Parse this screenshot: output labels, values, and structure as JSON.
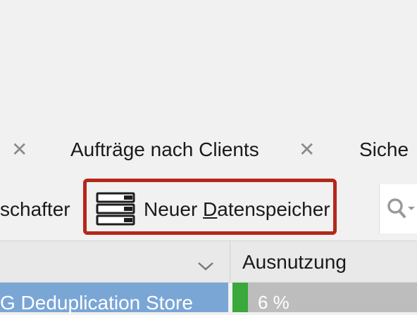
{
  "tabs": [
    {
      "label": "",
      "close": "✕"
    },
    {
      "label": "Aufträge nach Clients",
      "close": "✕"
    },
    {
      "label": "Siche"
    }
  ],
  "toolbar": {
    "properties_label": "schafter",
    "new_datastore_pre": "Neuer ",
    "new_datastore_mnemonic": "D",
    "new_datastore_post": "atenspeicher",
    "search_icon": "search-icon"
  },
  "table": {
    "columns": [
      "",
      "Ausnutzung"
    ],
    "rows": [
      {
        "name": "G Deduplication Store",
        "usage": "6 %",
        "usage_fraction": 0.06
      }
    ]
  },
  "colors": {
    "highlight": "#b5271b",
    "selection": "#7aa6d6",
    "usage_bar": "#3aa83a"
  }
}
